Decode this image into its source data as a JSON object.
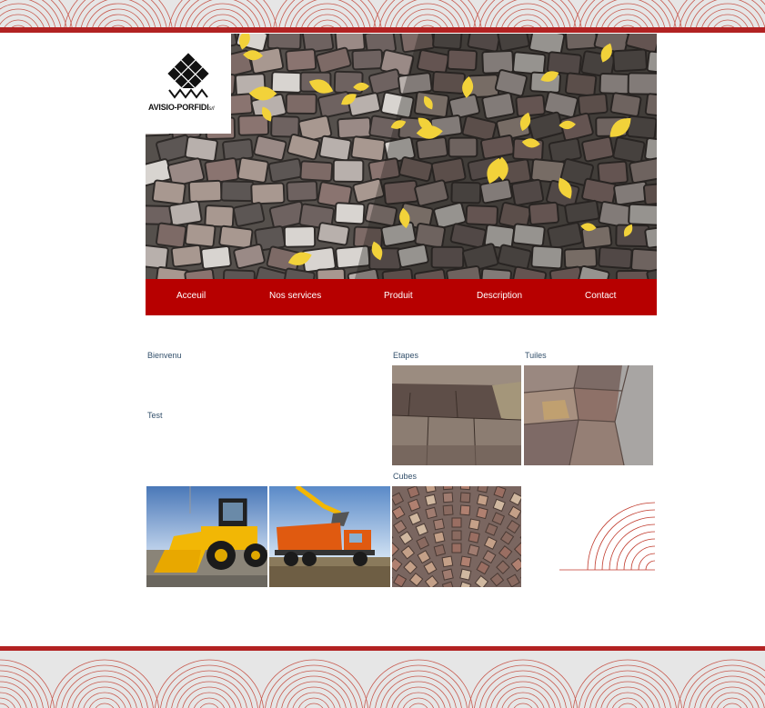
{
  "site": {
    "logo_text": "AVISIO-PORFIDI",
    "logo_suffix": "srl"
  },
  "nav": {
    "items": [
      "Acceuil",
      "Nos services",
      "Produit",
      "Description",
      "Contact"
    ]
  },
  "content": {
    "welcome": "Bienvenu",
    "test": "Test"
  },
  "gallery": {
    "etapes": "Etapes",
    "tuiles": "Tuiles",
    "cubes": "Cubes"
  },
  "theme": {
    "accent": "#b70000",
    "band_line": "#c0392b",
    "band_bg": "#e6e6e6",
    "label_color": "#33506b"
  }
}
